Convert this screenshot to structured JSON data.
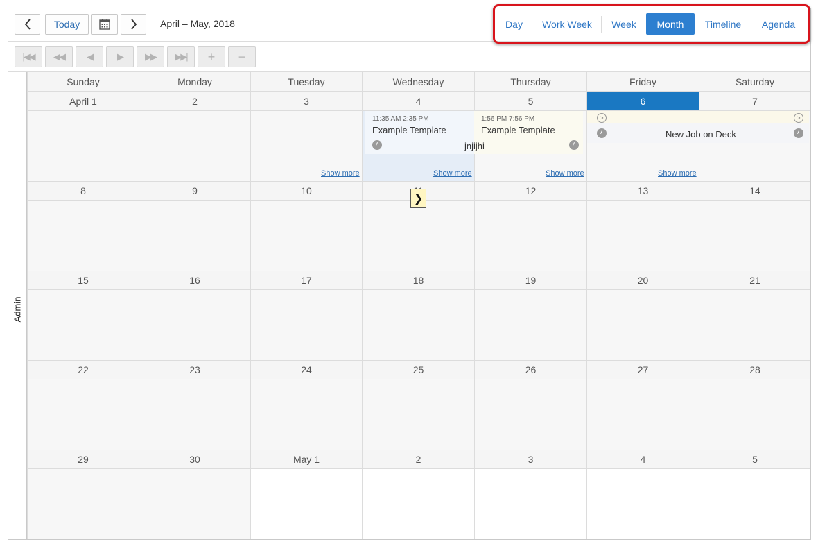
{
  "toolbar": {
    "prev_icon": "chevron-left-icon",
    "today_label": "Today",
    "calendar_icon": "calendar-icon",
    "next_icon": "chevron-right-icon",
    "range_label": "April – May, 2018"
  },
  "views": [
    {
      "label": "Day",
      "active": false
    },
    {
      "label": "Work Week",
      "active": false
    },
    {
      "label": "Week",
      "active": false
    },
    {
      "label": "Month",
      "active": true
    },
    {
      "label": "Timeline",
      "active": false
    },
    {
      "label": "Agenda",
      "active": false
    }
  ],
  "nav_buttons": [
    "first-icon",
    "fast-back-icon",
    "back-icon",
    "forward-icon",
    "fast-forward-icon",
    "last-icon",
    "plus-icon",
    "minus-icon"
  ],
  "nav_plus_label": "+",
  "nav_minus_label": "−",
  "colors": {
    "accent": "#2d7fd0",
    "today": "#1a78c2",
    "highlight": "#d8141c"
  },
  "resource": "Admin",
  "day_names": [
    "Sunday",
    "Monday",
    "Tuesday",
    "Wednesday",
    "Thursday",
    "Friday",
    "Saturday"
  ],
  "weeks": [
    [
      "April 1",
      "2",
      "3",
      "4",
      "5",
      "6",
      "7"
    ],
    [
      "8",
      "9",
      "10",
      "11",
      "12",
      "13",
      "14"
    ],
    [
      "15",
      "16",
      "17",
      "18",
      "19",
      "20",
      "21"
    ],
    [
      "22",
      "23",
      "24",
      "25",
      "26",
      "27",
      "28"
    ],
    [
      "29",
      "30",
      "May 1",
      "2",
      "3",
      "4",
      "5"
    ]
  ],
  "today_date": "6",
  "show_more_label": "Show more",
  "events": {
    "wed": {
      "time": "11:35 AM 2:35 PM",
      "title": "Example Template"
    },
    "thu": {
      "time": "1:56 PM 7:56 PM",
      "title": "Example Template"
    },
    "span_title": "jnjijhi",
    "fri": {
      "title": "New Job on Deck"
    }
  },
  "tooltip_icon": "chevron-right-icon"
}
